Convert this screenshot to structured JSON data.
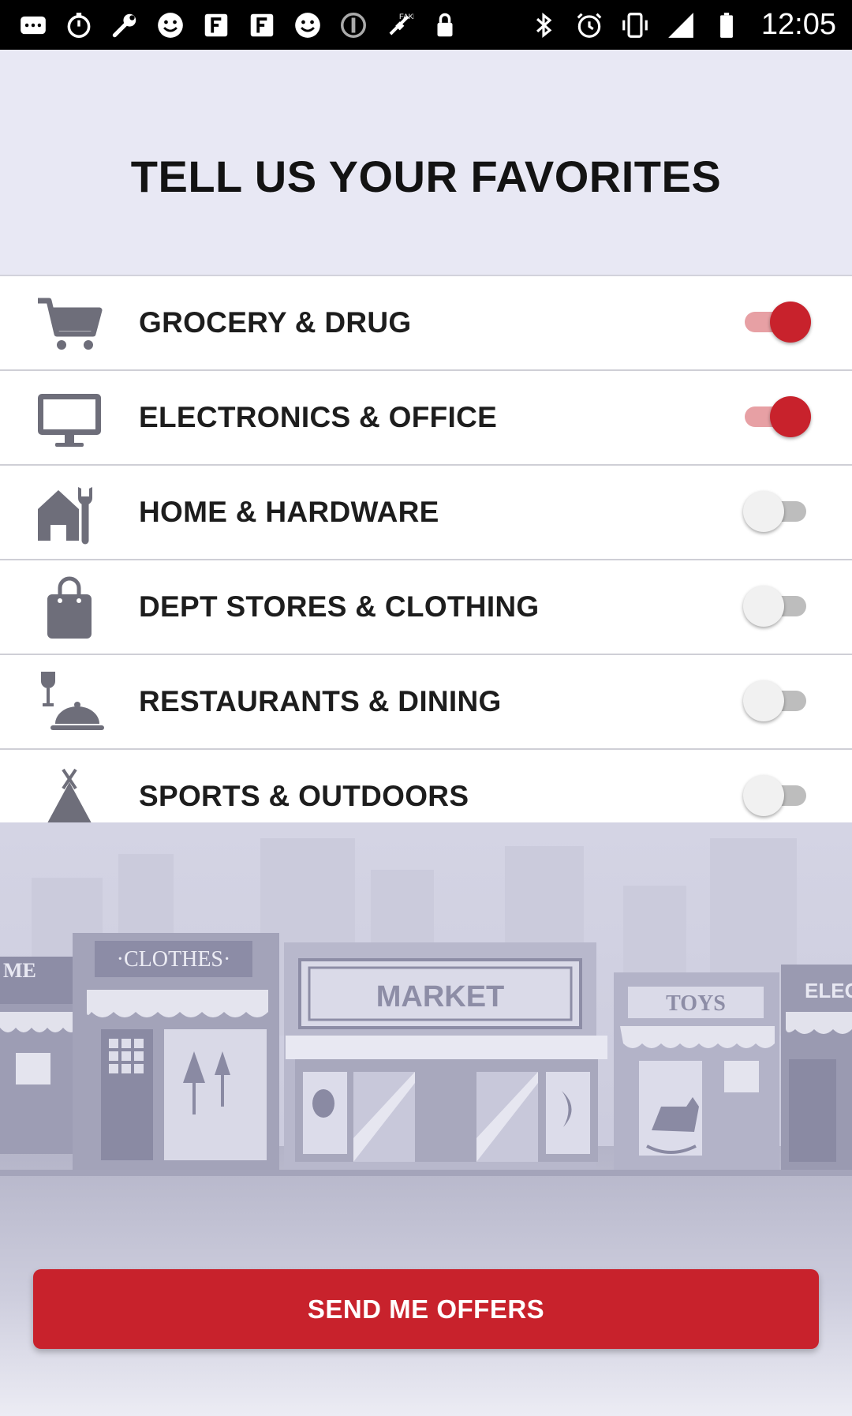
{
  "status_bar": {
    "time": "12:05",
    "left_icons": [
      "message-icon",
      "timer-icon",
      "wrench-icon",
      "smiley-icon",
      "font-icon",
      "font-icon",
      "smiley-icon",
      "record-icon",
      "satellite-icon",
      "lock-icon"
    ],
    "right_icons": [
      "bluetooth-icon",
      "alarm-icon",
      "vibrate-icon",
      "signal-icon",
      "battery-icon"
    ]
  },
  "header": {
    "title": "TELL US YOUR FAVORITES"
  },
  "categories": [
    {
      "label": "GROCERY & DRUG",
      "icon": "cart-icon",
      "enabled": true
    },
    {
      "label": "ELECTRONICS & OFFICE",
      "icon": "monitor-icon",
      "enabled": true
    },
    {
      "label": "HOME & HARDWARE",
      "icon": "house-wrench-icon",
      "enabled": false
    },
    {
      "label": "DEPT STORES & CLOTHING",
      "icon": "shopping-bag-icon",
      "enabled": false
    },
    {
      "label": "RESTAURANTS & DINING",
      "icon": "dining-icon",
      "enabled": false
    },
    {
      "label": "SPORTS & OUTDOORS",
      "icon": "tent-icon",
      "enabled": false
    }
  ],
  "scene": {
    "signs": {
      "clothes": "·CLOTHES·",
      "market": "MARKET",
      "toys": "TOYS",
      "left_partial": "ME",
      "right_partial": "ELEC"
    }
  },
  "cta": {
    "label": "SEND ME OFFERS"
  },
  "colors": {
    "accent": "#c8222c",
    "header_bg": "#e8e8f4",
    "icon_gray": "#6e6e7a"
  }
}
